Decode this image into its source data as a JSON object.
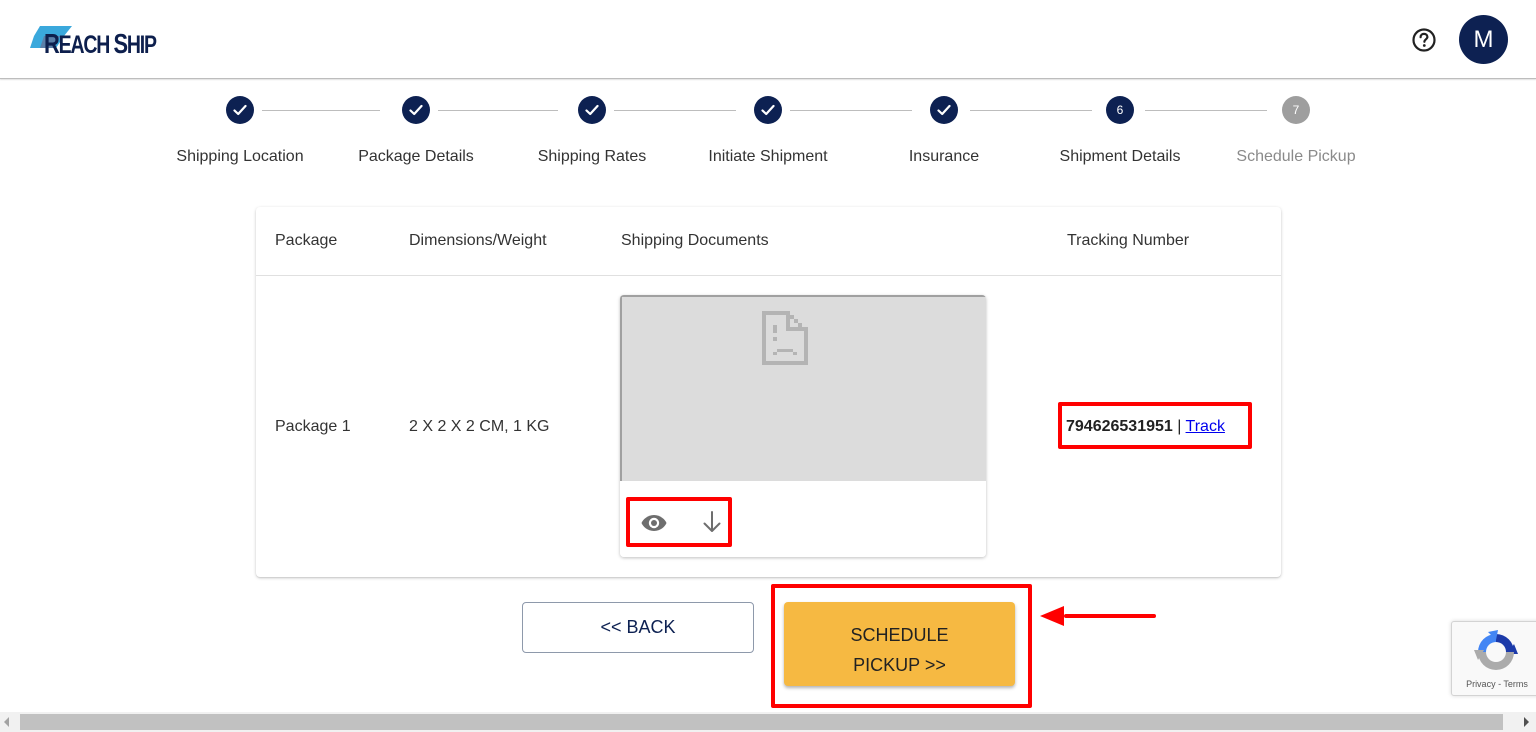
{
  "header": {
    "logo_text_first": "R",
    "logo_text_rest": "EACH",
    "logo_text_second_first": "S",
    "logo_text_second_rest": "HIP",
    "help_icon": "help-circle-icon",
    "avatar_initial": "M"
  },
  "stepper": {
    "steps": [
      {
        "label": "Shipping Location",
        "state": "done",
        "number": "1"
      },
      {
        "label": "Package Details",
        "state": "done",
        "number": "2"
      },
      {
        "label": "Shipping Rates",
        "state": "done",
        "number": "3"
      },
      {
        "label": "Initiate Shipment",
        "state": "done",
        "number": "4"
      },
      {
        "label": "Insurance",
        "state": "done",
        "number": "5"
      },
      {
        "label": "Shipment Details",
        "state": "active",
        "number": "6"
      },
      {
        "label": "Schedule Pickup",
        "state": "pending",
        "number": "7"
      }
    ]
  },
  "table": {
    "headers": {
      "package": "Package",
      "dimensions": "Dimensions/Weight",
      "documents": "Shipping Documents",
      "tracking": "Tracking Number"
    },
    "rows": [
      {
        "package": "Package 1",
        "dimensions": "2 X 2 X 2 CM, 1 KG",
        "document_preview": "broken-document-icon",
        "document_actions": [
          "eye-icon",
          "download-icon"
        ],
        "tracking_number": "794626531951",
        "tracking_separator": "|",
        "track_link": "Track"
      }
    ]
  },
  "buttons": {
    "back": "<< BACK",
    "schedule_line1": "SCHEDULE",
    "schedule_line2": "PICKUP >>"
  },
  "annotations": {
    "highlight_color": "#ff0000"
  },
  "recaptcha": {
    "privacy": "Privacy",
    "separator": " - ",
    "terms": "Terms"
  },
  "colors": {
    "primary": "#0d2152",
    "accent": "#f6b942",
    "pending": "#9e9e9e",
    "link": "#0000ee"
  }
}
